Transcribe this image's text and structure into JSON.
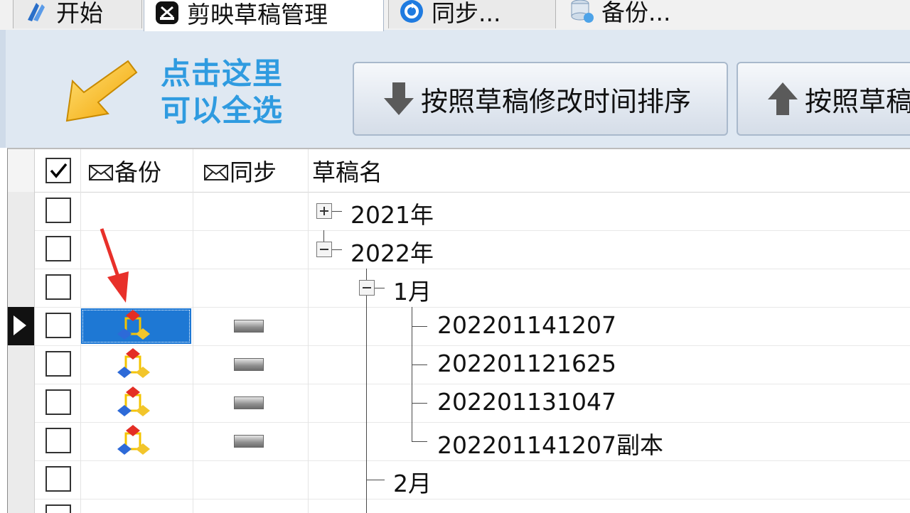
{
  "tabs": [
    {
      "label": "开始",
      "icon": "start-icon"
    },
    {
      "label": "剪映草稿管理",
      "icon": "capcut-icon",
      "active": true
    },
    {
      "label": "同步...",
      "icon": "sync-icon"
    },
    {
      "label": "备份...",
      "icon": "database-backup-icon"
    }
  ],
  "toolbar": {
    "hint_line1": "点击这里",
    "hint_line2": "可以全选",
    "sort_desc_label": "按照草稿修改时间排序",
    "sort_asc_label": "按照草稿",
    "accent_color": "#2f9be0"
  },
  "grid": {
    "columns": {
      "select_all": "checked",
      "backup": "备份",
      "sync": "同步",
      "name": "草稿名"
    },
    "rows": [
      {
        "level": 0,
        "label": "2021年",
        "expander": "plus",
        "checked": false
      },
      {
        "level": 0,
        "label": "2022年",
        "expander": "minus",
        "checked": false
      },
      {
        "level": 1,
        "label": "1月",
        "expander": "minus",
        "checked": false
      },
      {
        "level": 2,
        "label": "202201141207",
        "checked": false,
        "backup_icon": true,
        "sync_icon": true,
        "selected": true
      },
      {
        "level": 2,
        "label": "202201121625",
        "checked": false,
        "backup_icon": true,
        "sync_icon": true
      },
      {
        "level": 2,
        "label": "202201131047",
        "checked": false,
        "backup_icon": true,
        "sync_icon": true
      },
      {
        "level": 2,
        "label": "202201141207副本",
        "checked": false,
        "backup_icon": true,
        "sync_icon": true
      },
      {
        "level": 1,
        "label": "2月",
        "checked": false
      }
    ],
    "selection_color": "#1e78d4",
    "annotation_arrow_color": "#e8302a"
  }
}
